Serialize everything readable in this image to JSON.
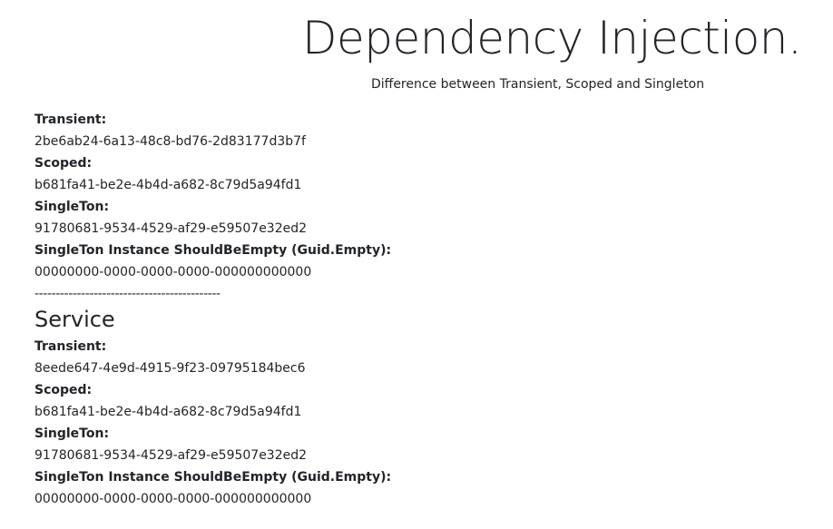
{
  "hero": {
    "title": "Dependency Injection.",
    "subtitle": "Difference between Transient, Scoped and Singleton"
  },
  "controller": {
    "transient_label": "Transient:",
    "transient_value": "2be6ab24-6a13-48c8-bd76-2d83177d3b7f",
    "scoped_label": "Scoped:",
    "scoped_value": "b681fa41-be2e-4b4d-a682-8c79d5a94fd1",
    "singleton_label": "SingleTon:",
    "singleton_value": "91780681-9534-4529-af29-e59507e32ed2",
    "singleton_instance_label": "SingleTon Instance ShouldBeEmpty (Guid.Empty):",
    "singleton_instance_value": "00000000-0000-0000-0000-000000000000"
  },
  "divider": "--------------------------------------------",
  "service": {
    "heading": "Service",
    "transient_label": "Transient:",
    "transient_value": "8eede647-4e9d-4915-9f23-09795184bec6",
    "scoped_label": "Scoped:",
    "scoped_value": "b681fa41-be2e-4b4d-a682-8c79d5a94fd1",
    "singleton_label": "SingleTon:",
    "singleton_value": "91780681-9534-4529-af29-e59507e32ed2",
    "singleton_instance_label": "SingleTon Instance ShouldBeEmpty (Guid.Empty):",
    "singleton_instance_value": "00000000-0000-0000-0000-000000000000"
  }
}
